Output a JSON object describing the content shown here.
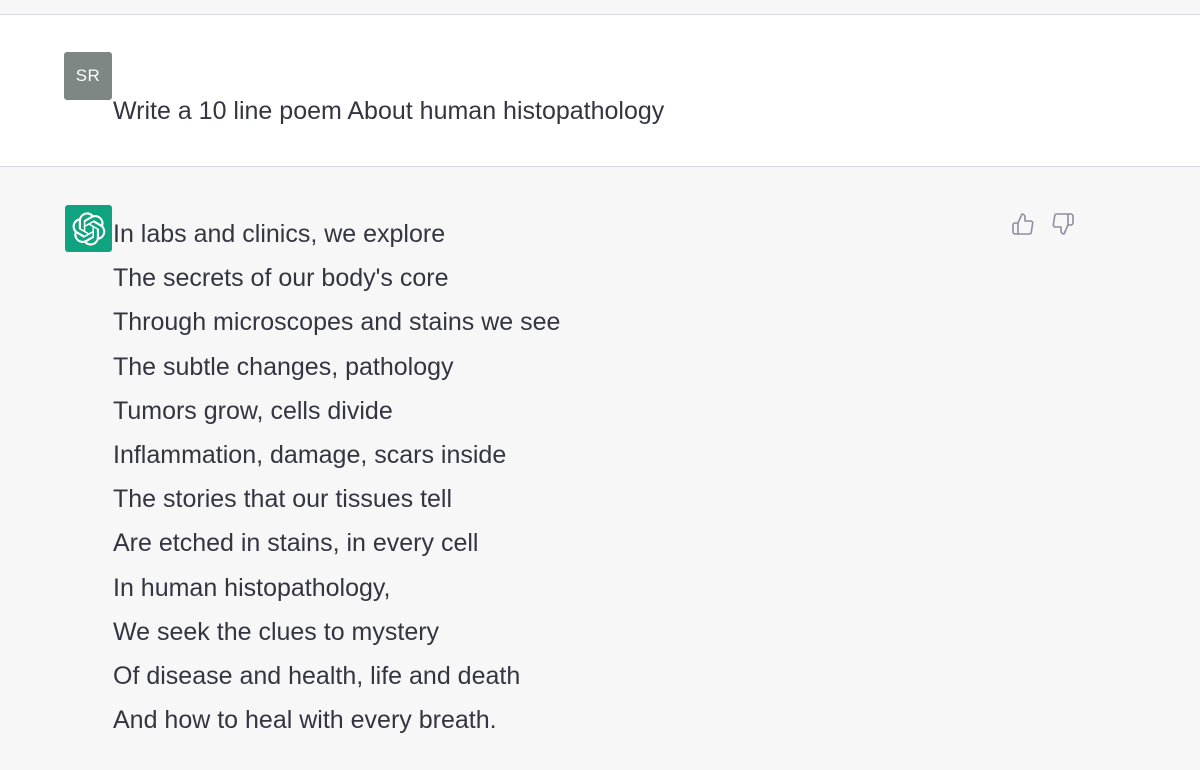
{
  "user_message": {
    "avatar_initials": "SR",
    "text": "Write a 10 line poem About human histopathology"
  },
  "assistant_message": {
    "avatar_icon": "openai-logo-icon",
    "lines": [
      "In labs and clinics, we explore",
      "The secrets of our body's core",
      "Through microscopes and stains we see",
      "The subtle changes, pathology",
      "Tumors grow, cells divide",
      "Inflammation, damage, scars inside",
      "The stories that our tissues tell",
      "Are etched in stains, in every cell",
      "In human histopathology,",
      "We seek the clues to mystery",
      "Of disease and health, life and death",
      "And how to heal with every breath."
    ],
    "feedback": {
      "thumbs_up_icon": "thumbs-up-icon",
      "thumbs_down_icon": "thumbs-down-icon"
    }
  },
  "colors": {
    "user_avatar_bg": "#7f8784",
    "assistant_avatar_bg": "#10a37f",
    "assistant_row_bg": "#f7f7f8",
    "user_row_bg": "#ffffff",
    "text": "#343541",
    "icon": "#8e8ea0"
  }
}
